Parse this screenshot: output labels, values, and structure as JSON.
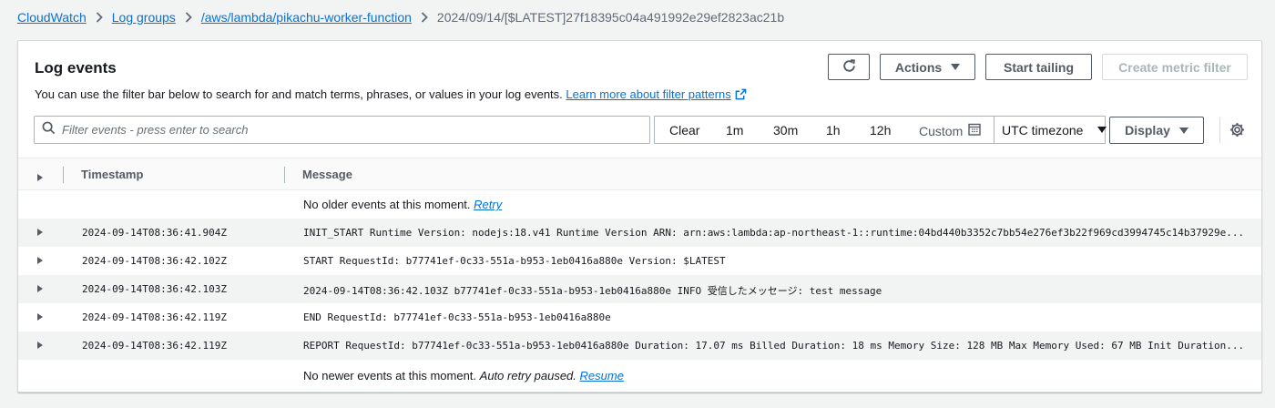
{
  "breadcrumb": {
    "items": [
      "CloudWatch",
      "Log groups",
      "/aws/lambda/pikachu-worker-function"
    ],
    "current": "2024/09/14/[$LATEST]27f18395c04a491992e29ef2823ac21b"
  },
  "panel": {
    "title": "Log events",
    "description": "You can use the filter bar below to search for and match terms, phrases, or values in your log events.",
    "learn_more": "Learn more about filter patterns",
    "actions_label": "Actions",
    "start_tailing_label": "Start tailing",
    "create_metric_label": "Create metric filter"
  },
  "filter": {
    "placeholder": "Filter events - press enter to search",
    "clear": "Clear",
    "ranges": [
      "1m",
      "30m",
      "1h",
      "12h"
    ],
    "custom": "Custom",
    "timezone": "UTC timezone",
    "display": "Display"
  },
  "table": {
    "col_timestamp": "Timestamp",
    "col_message": "Message",
    "older_text": "No older events at this moment.",
    "retry": "Retry",
    "newer_text": "No newer events at this moment.",
    "auto_retry": "Auto retry paused.",
    "resume": "Resume",
    "rows": [
      {
        "timestamp": "2024-09-14T08:36:41.904Z",
        "message": "INIT_START Runtime Version: nodejs:18.v41 Runtime Version ARN: arn:aws:lambda:ap-northeast-1::runtime:04bd440b3352c7bb54e276ef3b22f969cd3994745c14b37929e..."
      },
      {
        "timestamp": "2024-09-14T08:36:42.102Z",
        "message": "START RequestId: b77741ef-0c33-551a-b953-1eb0416a880e Version: $LATEST"
      },
      {
        "timestamp": "2024-09-14T08:36:42.103Z",
        "message": "2024-09-14T08:36:42.103Z b77741ef-0c33-551a-b953-1eb0416a880e INFO 受信したメッセージ: test message"
      },
      {
        "timestamp": "2024-09-14T08:36:42.119Z",
        "message": "END RequestId: b77741ef-0c33-551a-b953-1eb0416a880e"
      },
      {
        "timestamp": "2024-09-14T08:36:42.119Z",
        "message": "REPORT RequestId: b77741ef-0c33-551a-b953-1eb0416a880e Duration: 17.07 ms Billed Duration: 18 ms Memory Size: 128 MB Max Memory Used: 67 MB Init Duration..."
      }
    ]
  }
}
